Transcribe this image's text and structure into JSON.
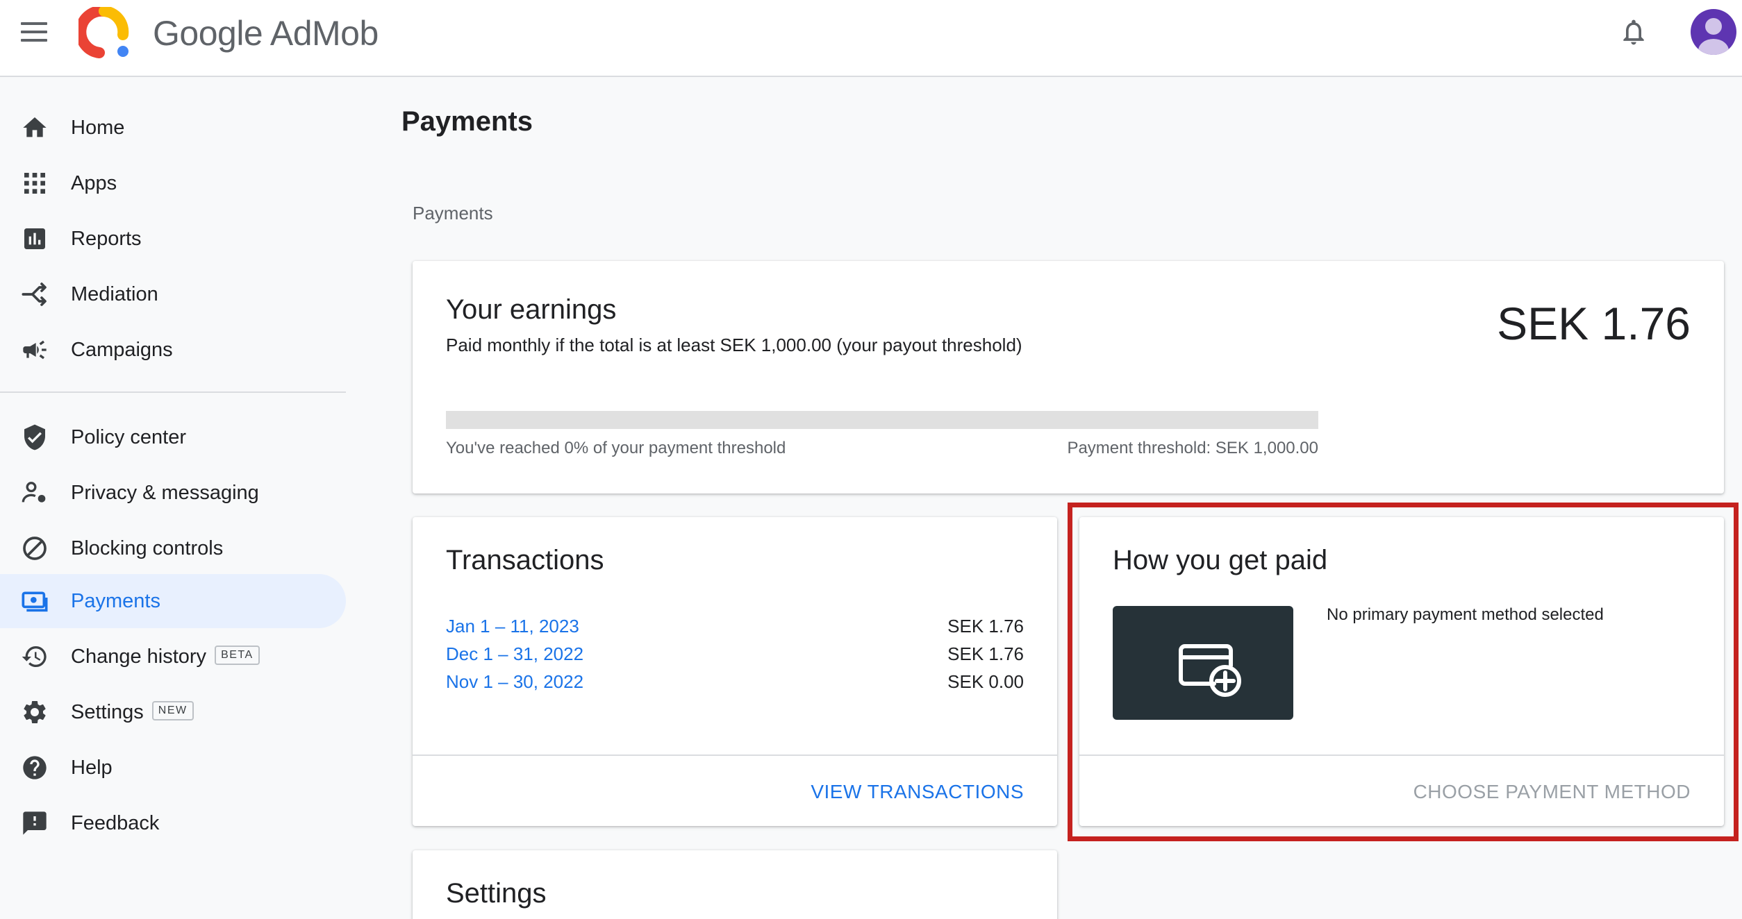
{
  "header": {
    "brand": "Google AdMob",
    "logo_colors": [
      "#ea4335",
      "#fbbc04",
      "#4285f4"
    ],
    "avatar_color": "#5e35b1"
  },
  "sidebar": {
    "items": [
      {
        "label": "Home",
        "icon": "home-icon"
      },
      {
        "label": "Apps",
        "icon": "apps-grid-icon"
      },
      {
        "label": "Reports",
        "icon": "bar-chart-icon"
      },
      {
        "label": "Mediation",
        "icon": "mediation-icon"
      },
      {
        "label": "Campaigns",
        "icon": "megaphone-icon"
      },
      {
        "label": "Policy center",
        "icon": "shield-check-icon"
      },
      {
        "label": "Privacy & messaging",
        "icon": "person-settings-icon"
      },
      {
        "label": "Blocking controls",
        "icon": "block-icon"
      },
      {
        "label": "Payments",
        "icon": "payments-icon",
        "active": true
      },
      {
        "label": "Change history",
        "icon": "history-icon",
        "badge": "BETA"
      },
      {
        "label": "Settings",
        "icon": "gear-icon",
        "badge": "NEW"
      },
      {
        "label": "Help",
        "icon": "help-icon"
      },
      {
        "label": "Feedback",
        "icon": "feedback-icon"
      }
    ]
  },
  "main": {
    "page_title": "Payments",
    "breadcrumb": "Payments",
    "earnings": {
      "title": "Your earnings",
      "description": "Paid monthly if the total is at least SEK 1,000.00 (your payout threshold)",
      "amount": "SEK 1.76",
      "progress_percent": 0,
      "progress_text": "You've reached 0% of your payment threshold",
      "threshold_text": "Payment threshold: SEK 1,000.00"
    },
    "transactions": {
      "title": "Transactions",
      "rows": [
        {
          "date": "Jan 1 – 11, 2023",
          "amount": "SEK 1.76"
        },
        {
          "date": "Dec 1 – 31, 2022",
          "amount": "SEK 1.76"
        },
        {
          "date": "Nov 1 – 30, 2022",
          "amount": "SEK 0.00"
        }
      ],
      "action": "VIEW TRANSACTIONS"
    },
    "payment_method": {
      "title": "How you get paid",
      "status": "No primary payment method selected",
      "action": "CHOOSE PAYMENT METHOD"
    },
    "settings": {
      "title": "Settings"
    }
  },
  "colors": {
    "accent": "#1a73e8",
    "highlight_border": "#c5221f",
    "disabled_text": "#9aa0a6"
  }
}
